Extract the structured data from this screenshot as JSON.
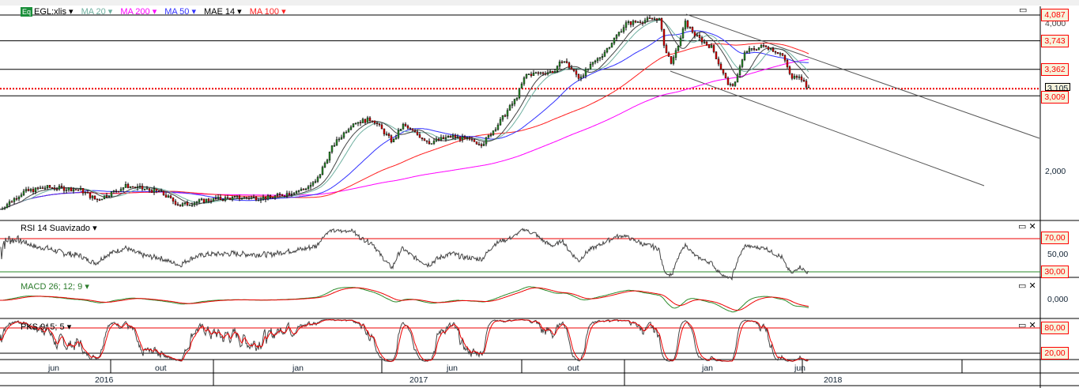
{
  "legend": {
    "symbol": "EGL:xlis",
    "items": [
      {
        "label": "MA 20",
        "color": "#6fb0a0"
      },
      {
        "label": "MA 200",
        "color": "#ff00ff"
      },
      {
        "label": "MA 50",
        "color": "#3333ff"
      },
      {
        "label": "MAE 14",
        "color": "#000000"
      },
      {
        "label": "MA 100",
        "color": "#ff2020"
      }
    ],
    "eq_badge": "Eq"
  },
  "panels": {
    "rsi": "RSI 14 Suavizado",
    "macd": "MACD 26; 12; 9",
    "pks": "PKS 9; 5; 5"
  },
  "chart_data": {
    "type": "line",
    "title": "EGL:xlis",
    "price_series": {
      "x_months_from_apr2016": [
        0,
        0.7,
        1.4,
        2.4,
        2.9,
        3.8,
        4.8,
        5.4,
        6.2,
        7.1,
        8.1,
        9.1,
        9.5,
        10,
        10.6,
        11.2,
        11.8,
        12.1,
        12.9,
        13.6,
        14.5,
        15,
        15.5,
        15.8,
        16.7,
        16.9,
        17.4,
        18.1,
        18.8,
        19.8,
        20,
        20.2,
        20.6,
        20.9,
        21.4,
        21.8,
        22,
        22.4,
        23,
        23.5,
        23.8,
        24,
        24.3
      ],
      "close": [
        1495,
        1727,
        1790,
        1760,
        1620,
        1810,
        1727,
        1550,
        1620,
        1650,
        1650,
        1760,
        1860,
        2340,
        2650,
        2700,
        2390,
        2620,
        2390,
        2470,
        2370,
        2650,
        2970,
        3290,
        3340,
        3500,
        3250,
        3560,
        3970,
        4050,
        3600,
        3440,
        3990,
        3810,
        3650,
        3230,
        3100,
        3600,
        3680,
        3560,
        3230,
        3300,
        3100
      ]
    },
    "price_levels": [
      {
        "value": 4087,
        "label": "4,087",
        "style": "solid"
      },
      {
        "value": 3743,
        "label": "3,743",
        "style": "solid"
      },
      {
        "value": 3362,
        "label": "3,362",
        "style": "solid"
      },
      {
        "value": 3105,
        "label": "3,105",
        "style": "dotted-red"
      },
      {
        "value": 3009,
        "label": "3,009",
        "style": "solid"
      }
    ],
    "y_ticks": [
      "4,000",
      "2,000"
    ],
    "ylim": [
      1358,
      4190
    ],
    "rsi_levels": [
      "70,00",
      "50,00",
      "30,00"
    ],
    "macd_ticks": [
      "0,000"
    ],
    "pks_levels": [
      "80,00",
      "20,00"
    ],
    "x_months": [
      "jun",
      "out",
      "jan",
      "jun",
      "out",
      "jan",
      "jun"
    ],
    "x_years": [
      "2016",
      "2017",
      "2018"
    ],
    "grid": false
  }
}
